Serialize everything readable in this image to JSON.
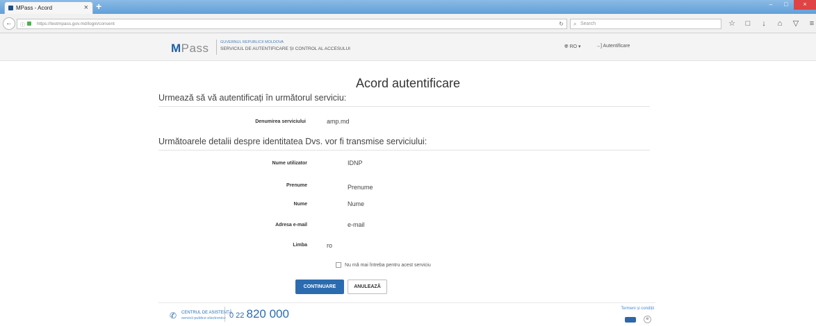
{
  "browser": {
    "tab_title": "MPass - Acord",
    "tab_close": "×",
    "new_tab": "+",
    "url": "https://testmpass.gov.md/login/consent",
    "search_placeholder": "Search",
    "window_buttons": [
      "–",
      "□",
      "×"
    ]
  },
  "header": {
    "logo_m": "M",
    "logo_rest": "Pass",
    "gov_line1": "GUVERNUL REPUBLICII MOLDOVA",
    "gov_line2": "SERVICIUL DE AUTENTIFICARE ȘI CONTROL AL ACCESULUI",
    "language": "RO",
    "auth_link": "Autentificare"
  },
  "main": {
    "title": "Acord autentificare",
    "section1": "Urmează să vă autentificați în următorul serviciu:",
    "service_label": "Denumirea serviciului",
    "service_value": "amp.md",
    "section2": "Următoarele detalii despre identitatea Dvs. vor fi transmise serviciului:",
    "fields": [
      {
        "label": "Nume utilizator",
        "value": "IDNP"
      },
      {
        "label": "Prenume",
        "value": "Prenume"
      },
      {
        "label": "Nume",
        "value": "Nume"
      },
      {
        "label": "Adresa e-mail",
        "value": "e-mail"
      },
      {
        "label": "Limba",
        "value": "ro"
      }
    ],
    "checkbox_label": "Nu mă mai întreba pentru acest serviciu",
    "continue_button": "CONTINUARE",
    "cancel_button": "ANULEAZĂ"
  },
  "footer": {
    "center_title": "CENTRUL DE ASISTENȚĂ",
    "center_sub": "servicii publice electronice",
    "phone_prefix": "0 22",
    "phone_number": "820 000",
    "terms": "Termeni și condiții",
    "egov": "e"
  },
  "colors": {
    "primary": "#2b6cb0",
    "tabbar": "#6fa8dc"
  }
}
